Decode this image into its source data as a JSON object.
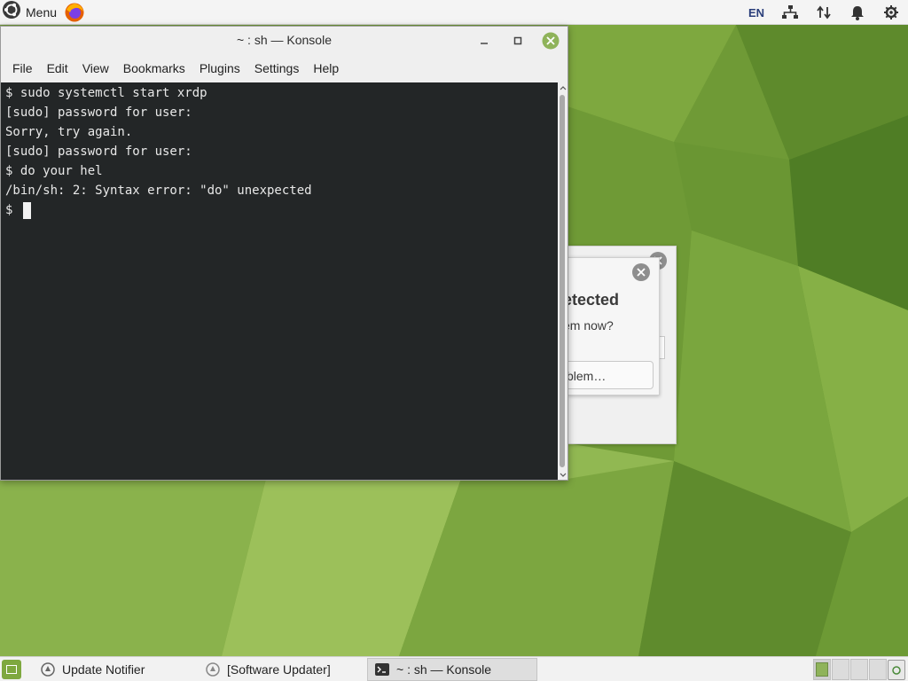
{
  "top_panel": {
    "menu_label": "Menu",
    "tray": {
      "language": "EN"
    }
  },
  "konsole": {
    "title": "~ : sh — Konsole",
    "menus": [
      "File",
      "Edit",
      "View",
      "Bookmarks",
      "Plugins",
      "Settings",
      "Help"
    ],
    "lines": [
      "$ sudo systemctl start xrdp",
      "[sudo] password for user:",
      "Sorry, try again.",
      "[sudo] password for user:",
      "$ do your hel",
      "/bin/sh: 2: Syntax error: \"do\" unexpected",
      "$ "
    ]
  },
  "dialog": {
    "heading_fragment": "etected",
    "question_fragment": "em now?",
    "button_fragment": "blem…"
  },
  "taskbar": {
    "tasks": [
      {
        "label": "Update Notifier"
      },
      {
        "label": "[Software Updater]"
      },
      {
        "label": "~ : sh — Konsole"
      }
    ]
  },
  "colors": {
    "terminal_bg": "#232627",
    "wallpaper": "#6f9a36",
    "close_button": "#8fb35a"
  }
}
